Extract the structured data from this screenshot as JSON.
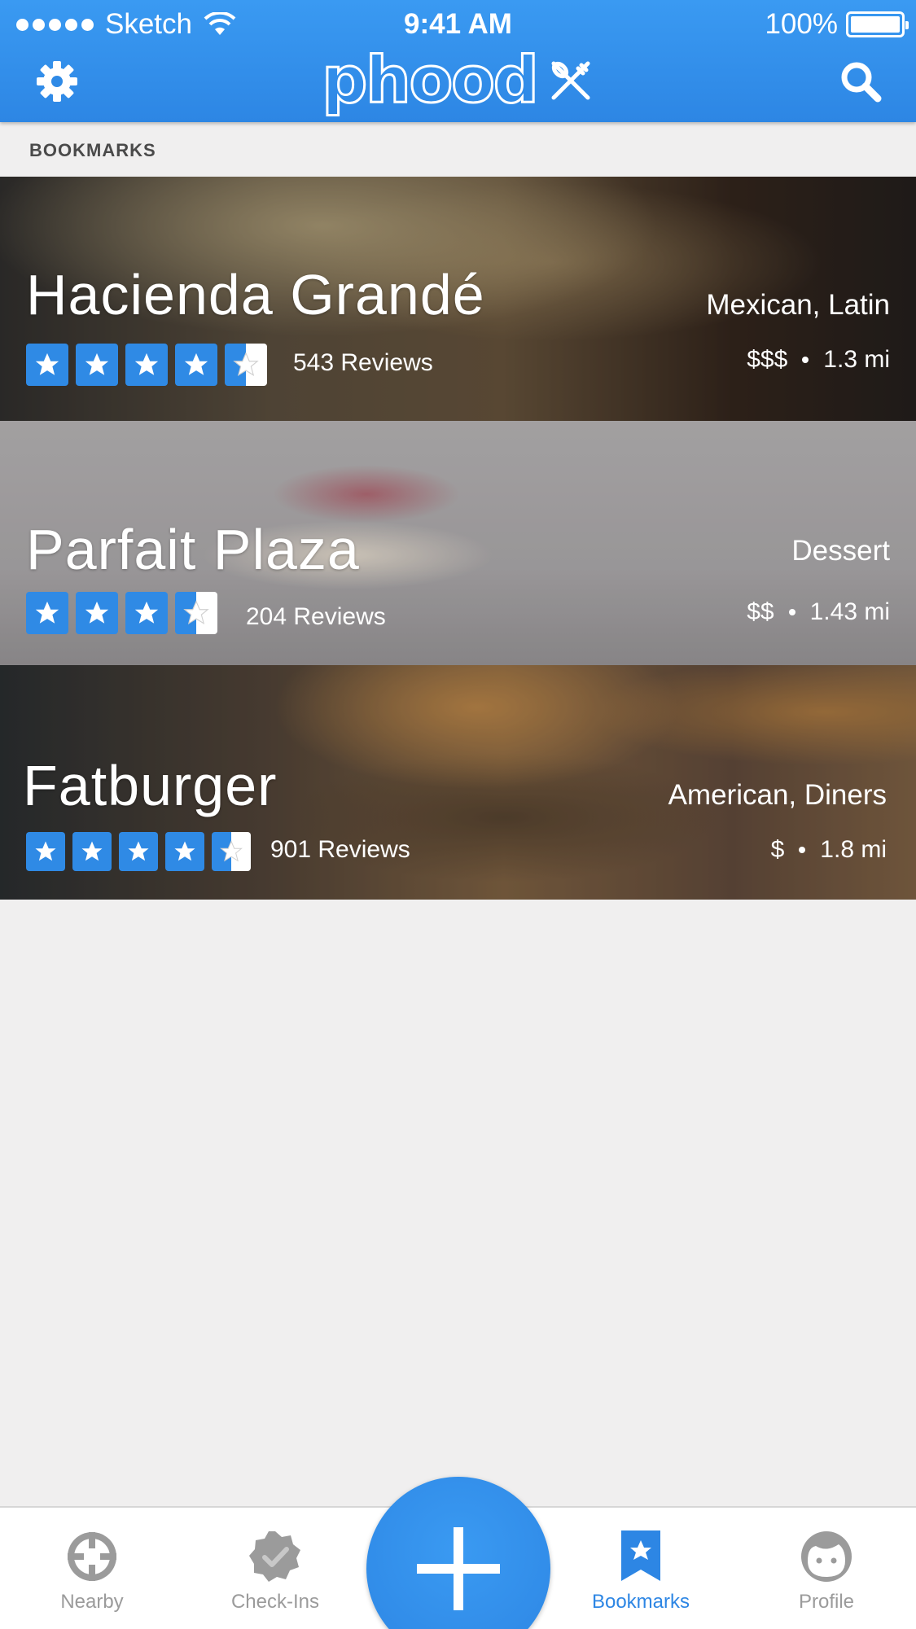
{
  "status_bar": {
    "carrier": "Sketch",
    "time": "9:41 AM",
    "battery": "100%"
  },
  "nav": {
    "logo_text": "phood",
    "settings_icon": "gear-icon",
    "search_icon": "search-icon"
  },
  "section_label": "BOOKMARKS",
  "restaurants": [
    {
      "name": "Hacienda Grandé",
      "cuisine": "Mexican, Latin",
      "price": "$$$",
      "distance": "1.3 mi",
      "reviews": "543 Reviews",
      "rating": 4.5
    },
    {
      "name": "Parfait Plaza",
      "cuisine": "Dessert",
      "price": "$$",
      "distance": "1.43 mi",
      "reviews": "204 Reviews",
      "rating": 3.5
    },
    {
      "name": "Fatburger",
      "cuisine": "American, Diners",
      "price": "$",
      "distance": "1.8 mi",
      "reviews": "901 Reviews",
      "rating": 4.5
    }
  ],
  "tabs": [
    {
      "label": "Nearby",
      "icon": "crosshair-icon"
    },
    {
      "label": "Check-Ins",
      "icon": "badge-check-icon"
    },
    {
      "label": "Bookmarks",
      "icon": "bookmark-icon",
      "active": true
    },
    {
      "label": "Profile",
      "icon": "face-icon"
    }
  ],
  "fab_icon": "plus-icon",
  "colors": {
    "brand": "#2d86e4",
    "inactive": "#9b9b9b",
    "background": "#f0efef"
  }
}
